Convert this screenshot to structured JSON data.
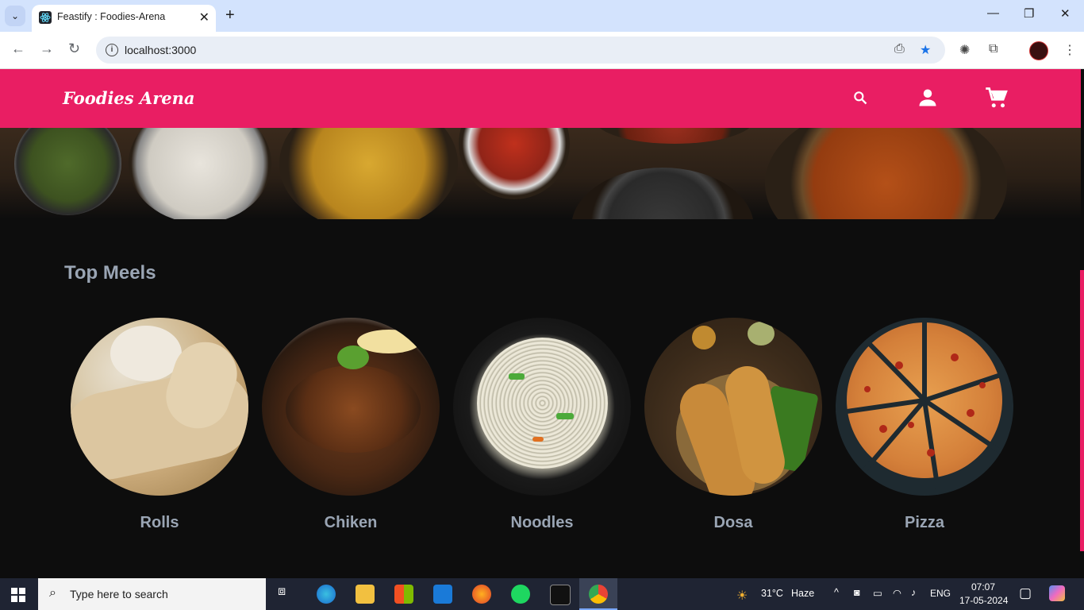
{
  "browser": {
    "tab_title": "Feastify : Foodies-Arena",
    "url": "localhost:3000",
    "icons": {
      "tab_search": "chevron-down-icon",
      "close_tab": "close-icon",
      "new_tab": "plus-icon",
      "back": "arrow-left-icon",
      "forward": "arrow-right-icon",
      "reload": "reload-icon",
      "info": "info-icon",
      "install": "install-app-icon",
      "bookmark": "star-icon",
      "extensions": "puzzle-icon",
      "menu": "kebab-menu-icon"
    }
  },
  "site": {
    "brand": "Foodies Arena",
    "accent_color": "#e91e63",
    "icons": [
      "search-icon",
      "user-icon",
      "cart-icon"
    ]
  },
  "section": {
    "title": "Top Meels"
  },
  "meals": [
    {
      "label": "Rolls"
    },
    {
      "label": "Chiken"
    },
    {
      "label": "Noodles"
    },
    {
      "label": "Dosa"
    },
    {
      "label": "Pizza"
    }
  ],
  "taskbar": {
    "search_placeholder": "Type here to search",
    "weather_temp": "31°C",
    "weather_desc": "Haze",
    "language": "ENG",
    "time": "07:07",
    "date": "17-05-2024"
  }
}
